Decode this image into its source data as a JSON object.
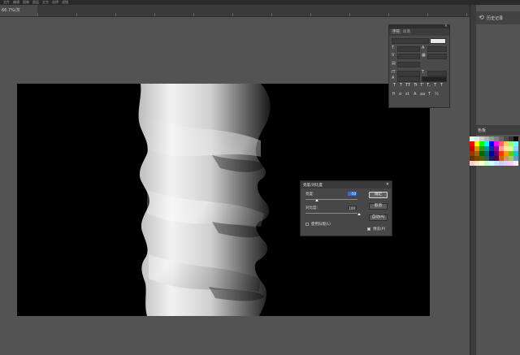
{
  "menu": {
    "items": [
      "文件",
      "编辑",
      "图像",
      "图层",
      "文字",
      "选择",
      "滤镜"
    ]
  },
  "document_tab": {
    "title": "66.7%(灰色/8#)",
    "close": "×"
  },
  "right_panel": {
    "history": {
      "label": "历史记录",
      "icon": "history-icon"
    },
    "swatches": {
      "label": "色板",
      "colors": [
        "#ffffff",
        "#e6e6e6",
        "#cccccc",
        "#b3b3b3",
        "#999999",
        "#808080",
        "#666666",
        "#4d4d4d",
        "#333333",
        "#000000",
        "#ff0000",
        "#ffff00",
        "#00ff00",
        "#00ffff",
        "#0000ff",
        "#ff00ff",
        "#ff6666",
        "#ffcc66",
        "#99ff66",
        "#66ffff",
        "#cc0000",
        "#cc9900",
        "#339900",
        "#009999",
        "#003399",
        "#990099",
        "#ff9999",
        "#ffe699",
        "#ccff99",
        "#99ccff",
        "#993300",
        "#996600",
        "#006600",
        "#006666",
        "#000099",
        "#660066",
        "#ff3300",
        "#ff9900",
        "#66cc00",
        "#00cccc",
        "#663300",
        "#804000",
        "#4d6600",
        "#335c5c",
        "#1a1a66",
        "#4d004d",
        "#cc6600",
        "#cc9966",
        "#99cc66",
        "#6699cc",
        "#ffcccc",
        "#ffe6cc",
        "#ffffcc",
        "#ccffcc",
        "#ccffff",
        "#cce6ff",
        "#ccccff",
        "#e6ccff",
        "#ffccff",
        "#f2f2f2"
      ]
    }
  },
  "character_panel": {
    "tab1": "字符",
    "tab2": "段落",
    "close": "×"
  },
  "dialog": {
    "title": "亮度/对比度",
    "close": "×",
    "brightness_label": "亮度:",
    "brightness_value": "-50",
    "contrast_label": "对比度:",
    "contrast_value": "100",
    "ok": "确定",
    "cancel": "取消",
    "auto": "自动(A)",
    "legacy": "使用旧版(L)",
    "preview": "预览(P)"
  },
  "colors": {
    "accent": "#2f6fd6",
    "panel": "#474747",
    "canvas": "#535353"
  }
}
